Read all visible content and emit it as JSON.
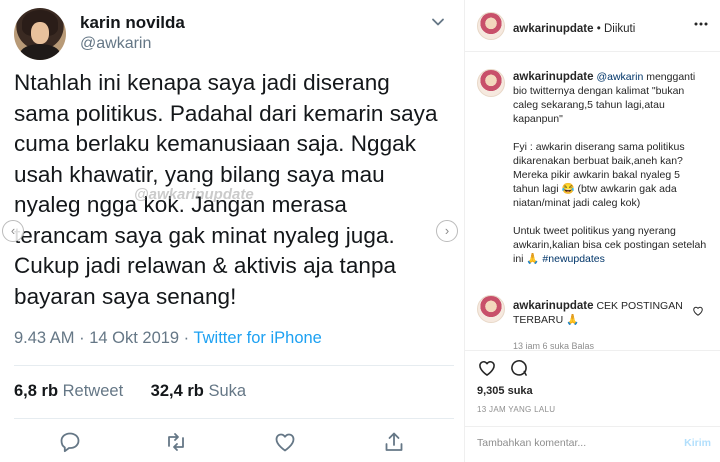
{
  "tweet": {
    "name": "karin novilda",
    "handle": "@awkarin",
    "lines": [
      "Ntahlah ini kenapa saya jadi diserang",
      "sama politikus. Padahal dari kemarin saya",
      "cuma berlaku kemanusiaan saja. Nggak",
      "usah khawatir, yang bilang saya mau",
      "nyaleg ngga kok. Jangan merasa",
      "terancam saya gak minat nyaleg juga.",
      "Cukup jadi relawan & aktivis aja tanpa",
      "bayaran saya senang!"
    ],
    "watermark": "@awkarinupdate",
    "time": "9.43 AM · 14 Okt 2019 · ",
    "source": "Twitter for iPhone",
    "retweets_count": "6,8 rb",
    "retweets_label": "Retweet",
    "likes_count": "32,4 rb",
    "likes_label": "Suka",
    "icons": [
      "reply-icon",
      "retweet-icon",
      "like-icon",
      "share-icon"
    ],
    "carousel": {
      "prev": "‹",
      "next": "›"
    }
  },
  "instagram": {
    "header": {
      "username": "awkarinupdate",
      "separator": " • ",
      "follow": "Diikuti"
    },
    "caption": {
      "username": "awkarinupdate",
      "mention": "@awkarin",
      "p1": " mengganti bio twitternya dengan kalimat \"bukan caleg sekarang,5 tahun lagi,atau kapanpun\"",
      "p2": "Fyi : awkarin diserang sama politikus dikarenakan berbuat baik,aneh kan? Mereka pikir awkarin bakal nyaleg 5 tahun lagi 😂 (btw awkarin gak ada niatan/minat jadi caleg kok)",
      "p3": "Untuk tweet politikus yang nyerang awkarin,kalian bisa cek postingan setelah ini 🙏 ",
      "hashtag": "#newupdates"
    },
    "comment": {
      "username": "awkarinupdate",
      "text": " CEK POSTINGAN TERBARU 🙏",
      "meta": "13 jam   6 suka   Balas"
    },
    "likes": "9,305 suka",
    "time": "13 JAM YANG LALU",
    "input_placeholder": "Tambahkan komentar...",
    "send": "Kirim"
  }
}
